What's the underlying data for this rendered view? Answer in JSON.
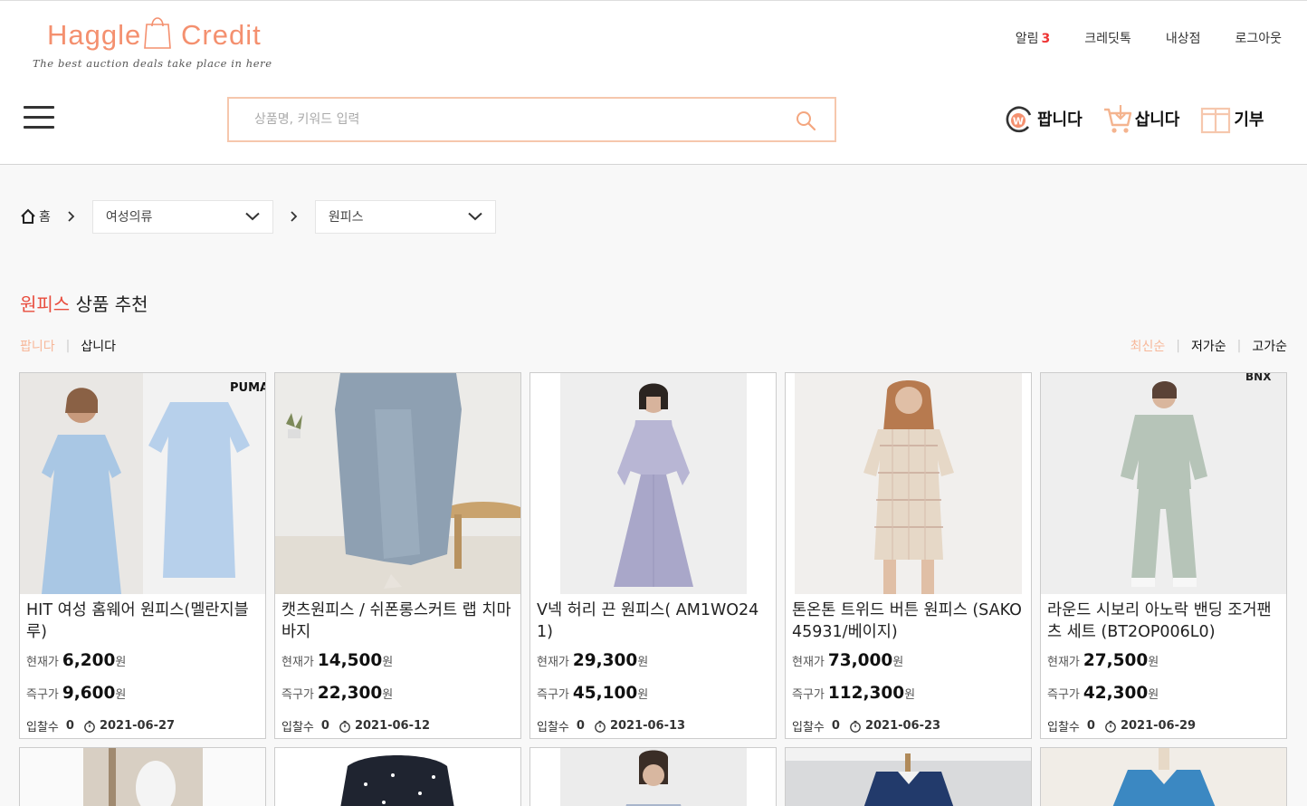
{
  "brand": {
    "word1": "Haggle",
    "word2": "Credit",
    "tagline": "The best auction deals take place in here"
  },
  "toplinks": {
    "notifications": "알림",
    "notification_count": "3",
    "credit_talk": "크레딧톡",
    "my_shop": "내상점",
    "logout": "로그아웃"
  },
  "search": {
    "placeholder": "상품명, 키워드 입력"
  },
  "modes": {
    "sell": "팝니다",
    "buy": "삽니다",
    "donate": "기부"
  },
  "breadcrumb": {
    "home": "홈",
    "category1": "여성의류",
    "category2": "원피스"
  },
  "section": {
    "title_accent": "원피스",
    "title_rest": "상품 추천"
  },
  "filter_tabs": {
    "sell": "팝니다",
    "buy": "삽니다"
  },
  "sort": {
    "latest": "최신순",
    "low": "저가순",
    "high": "고가순"
  },
  "labels": {
    "current_price": "현재가",
    "instant_price": "즉구가",
    "currency": "원",
    "bids": "입찰수"
  },
  "products": [
    {
      "name": "HIT 여성 홈웨어 원피스(멜란지블루)",
      "current": "6,200",
      "instant": "9,600",
      "bids": "0",
      "date": "2021-06-27",
      "brand_mark": "PUMA"
    },
    {
      "name": "캣츠원피스 / 쉬폰롱스커트 랩 치마바지",
      "current": "14,500",
      "instant": "22,300",
      "bids": "0",
      "date": "2021-06-12"
    },
    {
      "name": "V넥 허리 끈 원피스( AM1WO241)",
      "current": "29,300",
      "instant": "45,100",
      "bids": "0",
      "date": "2021-06-13"
    },
    {
      "name": "톤온톤 트위드 버튼 원피스 (SAKO45931/베이지)",
      "current": "73,000",
      "instant": "112,300",
      "bids": "0",
      "date": "2021-06-23"
    },
    {
      "name": "라운드 시보리 아노락 밴딩 조거팬츠 세트 (BT2OP006L0)",
      "current": "27,500",
      "instant": "42,300",
      "bids": "0",
      "date": "2021-06-29",
      "brand_mark": "BNX"
    }
  ],
  "colors": {
    "accent_orange": "#f4906f",
    "search_border": "#f6c7ad",
    "title_red": "#e84c3d"
  }
}
